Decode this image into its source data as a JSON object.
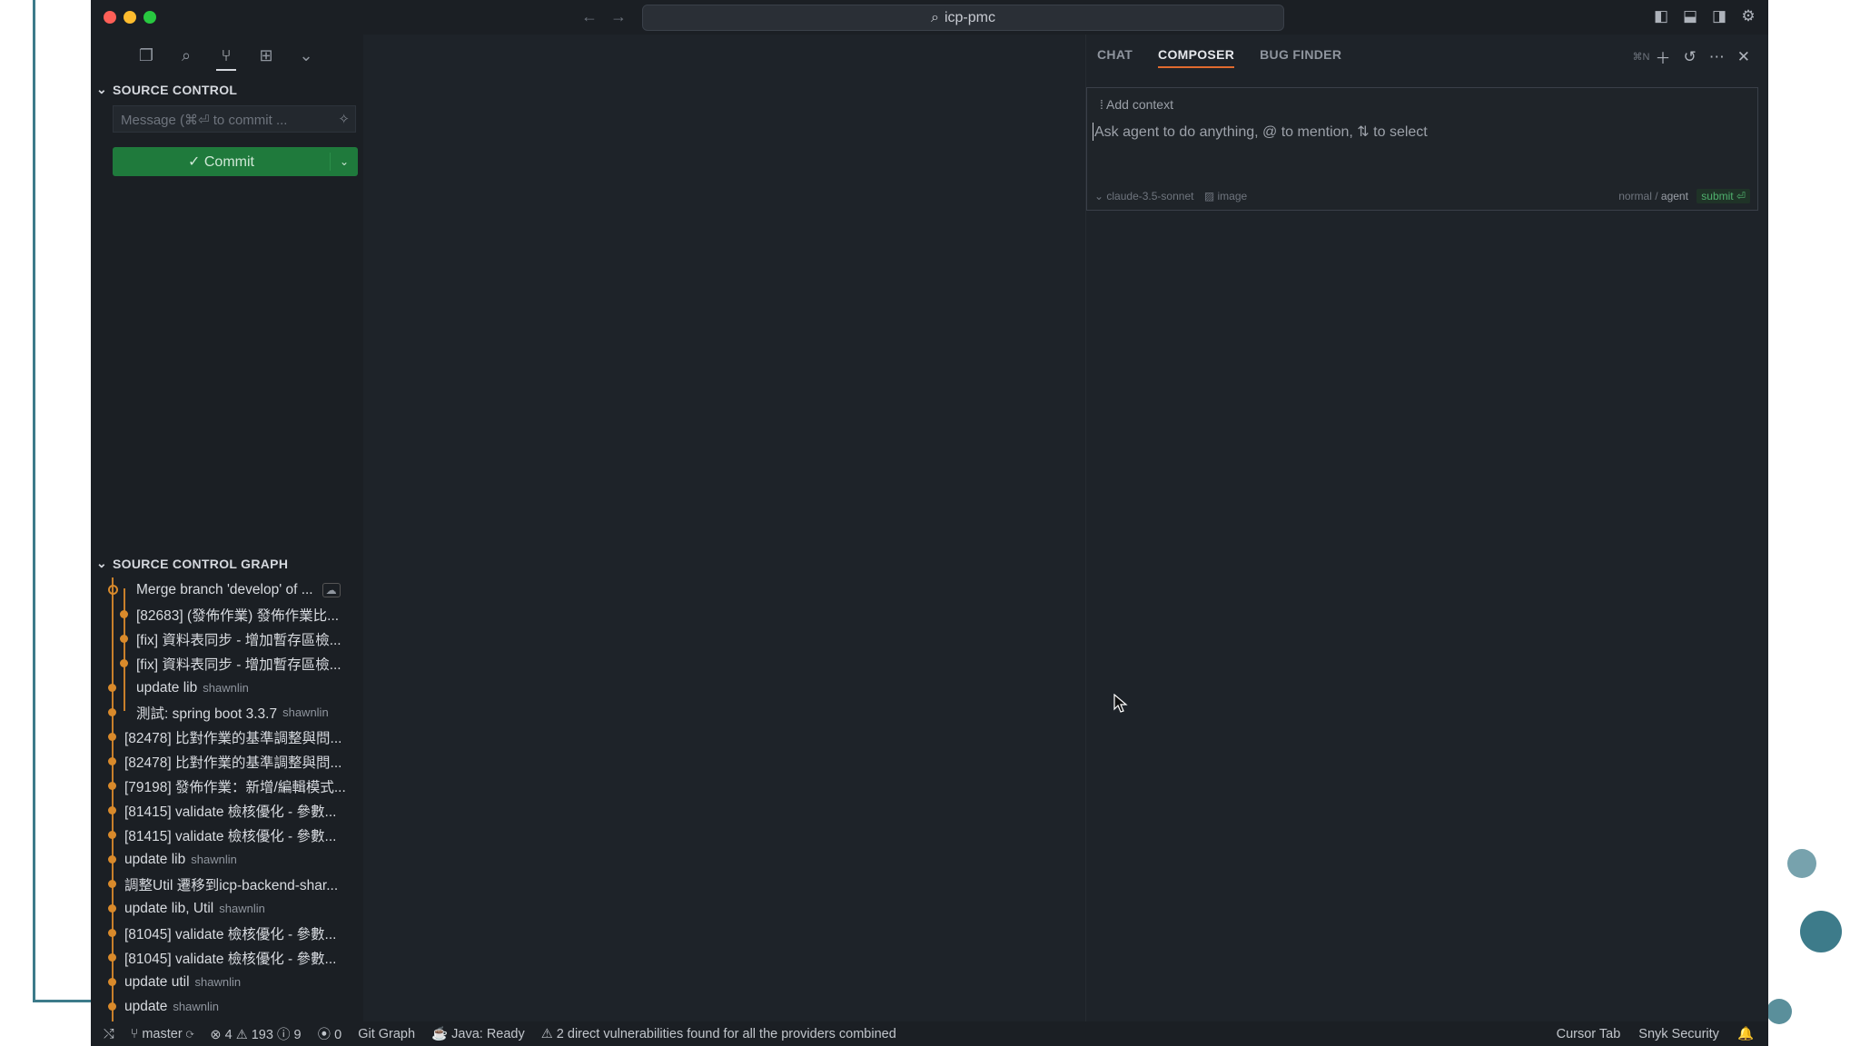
{
  "window": {
    "search_text": "icp-pmc"
  },
  "sidebar": {
    "source_control_title": "SOURCE CONTROL",
    "message_placeholder": "Message (⌘⏎ to commit ...",
    "commit_label": "Commit",
    "graph_title": "SOURCE CONTROL GRAPH",
    "graph": [
      {
        "message": "Merge branch 'develop' of ...",
        "author": ""
      },
      {
        "message": "[82683] (發佈作業) 發佈作業比...",
        "author": ""
      },
      {
        "message": "[fix] 資料表同步 - 增加暫存區檢...",
        "author": ""
      },
      {
        "message": "[fix] 資料表同步 - 增加暫存區檢...",
        "author": ""
      },
      {
        "message": "update lib",
        "author": "shawnlin"
      },
      {
        "message": "測試: spring boot 3.3.7",
        "author": "shawnlin"
      },
      {
        "message": "[82478] 比對作業的基準調整與問...",
        "author": ""
      },
      {
        "message": "[82478] 比對作業的基準調整與問...",
        "author": ""
      },
      {
        "message": "[79198] 發佈作業：新增/編輯模式...",
        "author": ""
      },
      {
        "message": "[81415] validate 檢核優化 - 參數...",
        "author": ""
      },
      {
        "message": "[81415] validate 檢核優化 - 參數...",
        "author": ""
      },
      {
        "message": "update lib",
        "author": "shawnlin"
      },
      {
        "message": "調整Util 遷移到icp-backend-shar...",
        "author": ""
      },
      {
        "message": "update lib, Util",
        "author": "shawnlin"
      },
      {
        "message": "[81045] validate 檢核優化 - 參數...",
        "author": ""
      },
      {
        "message": "[81045] validate 檢核優化 - 參數...",
        "author": ""
      },
      {
        "message": "update util",
        "author": "shawnlin"
      },
      {
        "message": "update",
        "author": "shawnlin"
      }
    ]
  },
  "panel": {
    "tabs": [
      "CHAT",
      "COMPOSER",
      "BUG FINDER"
    ],
    "shortcut": "⌘N",
    "add_context": "Add context",
    "prompt_placeholder": "Ask agent to do anything, @ to mention, ⇅ to select",
    "model": "claude-3.5-sonnet",
    "image_label": "image",
    "mode_normal": "normal",
    "mode_agent": "agent",
    "submit_label": "submit ⏎"
  },
  "statusbar": {
    "branch": "master",
    "errors": "4",
    "warnings": "193",
    "infos": "9",
    "ports": "0",
    "git_graph": "Git Graph",
    "java": "Java: Ready",
    "vulnerabilities": "2 direct vulnerabilities found for all the providers combined",
    "cursor_tab": "Cursor Tab",
    "snyk": "Snyk Security"
  },
  "colors": {
    "accent_tab": "#e06a2f",
    "commit_button": "#1f7a3c",
    "graph_orange": "#d98a2b",
    "deco_teal": "#3d7b8a"
  }
}
